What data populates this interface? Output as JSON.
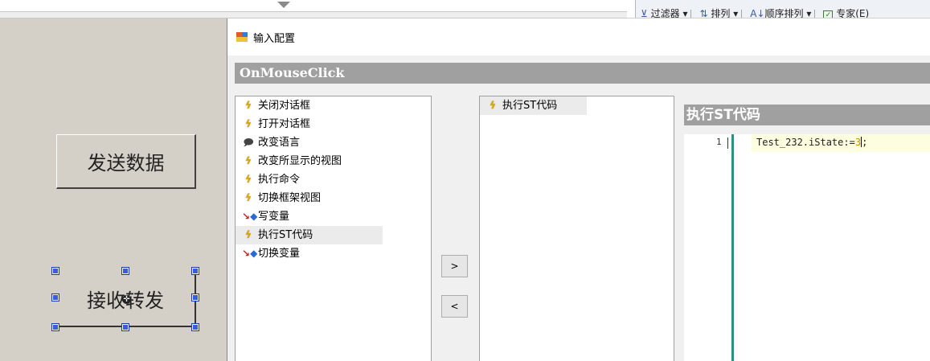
{
  "toolbar": {
    "filter_label": "过滤器",
    "sort_label": "排列",
    "order_label": "顺序排列",
    "partial_label": "专家(E)"
  },
  "canvas": {
    "send_button_label": "发送数据",
    "receive_button_label": "接收转发"
  },
  "dialog": {
    "title": "输入配置",
    "event_name": "OnMouseClick",
    "actions": [
      {
        "label": "关闭对话框",
        "icon": "bolt-icon"
      },
      {
        "label": "打开对话框",
        "icon": "bolt-icon"
      },
      {
        "label": "改变语言",
        "icon": "speech-icon"
      },
      {
        "label": "改变所显示的视图",
        "icon": "bolt-icon"
      },
      {
        "label": "执行命令",
        "icon": "bolt-icon"
      },
      {
        "label": "切换框架视图",
        "icon": "bolt-icon"
      },
      {
        "label": "写变量",
        "icon": "write-variable-icon"
      },
      {
        "label": "执行ST代码",
        "icon": "bolt-icon",
        "selected": true
      },
      {
        "label": "切换变量",
        "icon": "write-variable-icon"
      }
    ],
    "add_button_label": ">",
    "remove_button_label": "<",
    "configured_actions": [
      {
        "label": "执行ST代码",
        "icon": "bolt-icon",
        "selected": true
      }
    ],
    "st_panel_title": "执行ST代码",
    "code": {
      "line_number": "1",
      "text_before": "Test_232.iState:=",
      "number": "3",
      "text_after": ";"
    }
  },
  "colors": {
    "desktop_bg": "#d4d0c8",
    "header_bar": "#a0a0a0",
    "gutter_line": "#2f8f86",
    "selection_handle": "#3b5bdb"
  }
}
